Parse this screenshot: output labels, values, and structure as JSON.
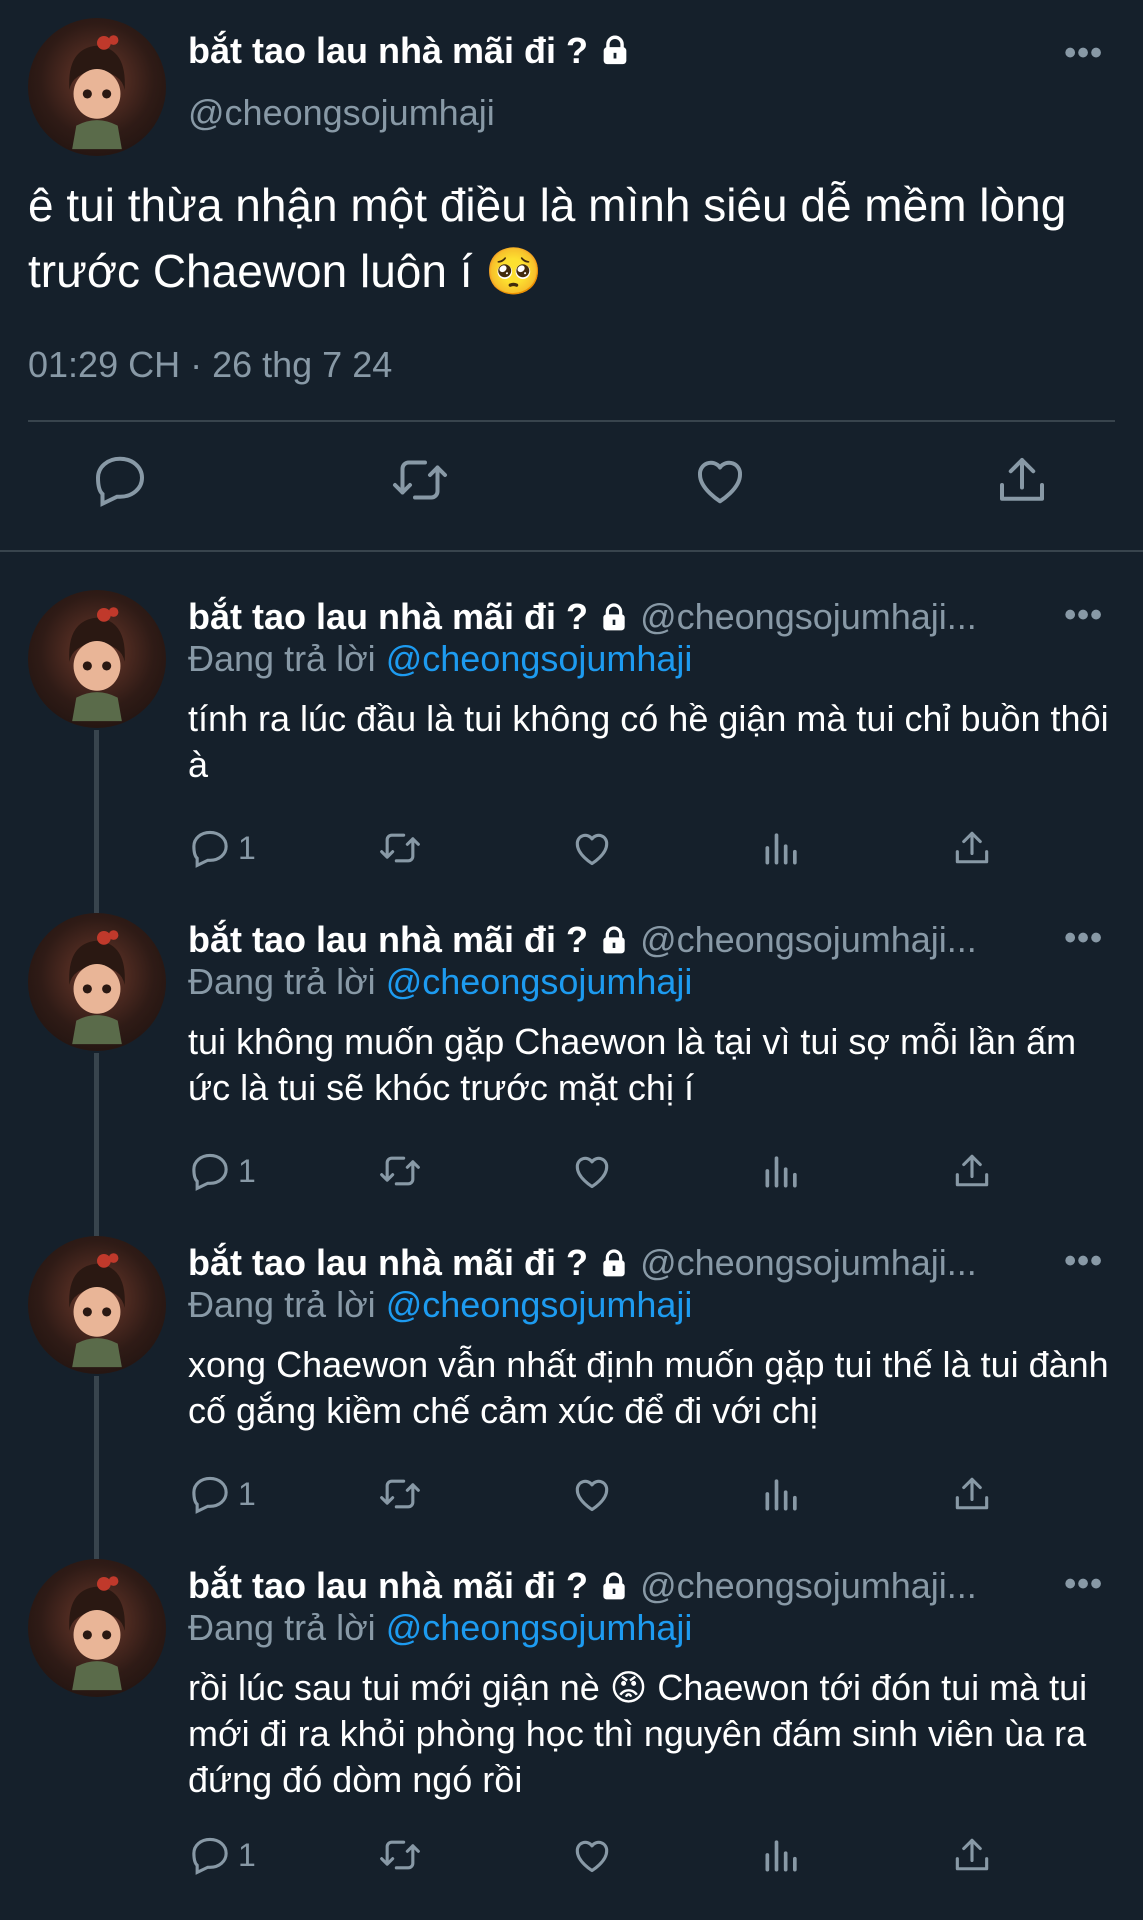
{
  "tweet": {
    "display_name": "bắt tao lau nhà mãi đi ?",
    "handle": "@cheongsojumhaji",
    "text": "ê tui thừa nhận một điều là mình siêu dễ mềm lòng trước Chaewon luôn í 🥺",
    "timestamp": "01:29 CH · 26 thg 7 24"
  },
  "replies": [
    {
      "display_name": "bắt tao lau nhà mãi đi ?",
      "handle": "@cheongsojumhaji...",
      "replying_label": "Đang trả lời",
      "replying_to": "@cheongsojumhaji",
      "text": "tính ra lúc đầu là tui không có hề giận mà tui chỉ buồn thôi à",
      "reply_count": "1"
    },
    {
      "display_name": "bắt tao lau nhà mãi đi ?",
      "handle": "@cheongsojumhaji...",
      "replying_label": "Đang trả lời",
      "replying_to": "@cheongsojumhaji",
      "text": "tui không muốn gặp Chaewon là tại vì tui sợ mỗi lần ấm ức là tui sẽ khóc trước mặt chị í",
      "reply_count": "1"
    },
    {
      "display_name": "bắt tao lau nhà mãi đi ?",
      "handle": "@cheongsojumhaji...",
      "replying_label": "Đang trả lời",
      "replying_to": "@cheongsojumhaji",
      "text": "xong Chaewon vẫn nhất định muốn gặp tui thế là tui đành cố gắng kiềm chế cảm xúc để đi với chị",
      "reply_count": "1"
    },
    {
      "display_name": "bắt tao lau nhà mãi đi ?",
      "handle": "@cheongsojumhaji...",
      "replying_label": "Đang trả lời",
      "replying_to": "@cheongsojumhaji",
      "text": "rồi lúc sau tui mới giận nè 😡  Chaewon tới đón tui mà tui mới đi ra khỏi phòng học thì nguyên đám sinh viên ùa ra đứng đó dòm ngó rồi",
      "reply_count": "1"
    }
  ],
  "colors": {
    "background": "#15202b",
    "text": "#ffffff",
    "muted": "#8899a6",
    "link": "#1d9bf0",
    "divider": "#38444d"
  }
}
